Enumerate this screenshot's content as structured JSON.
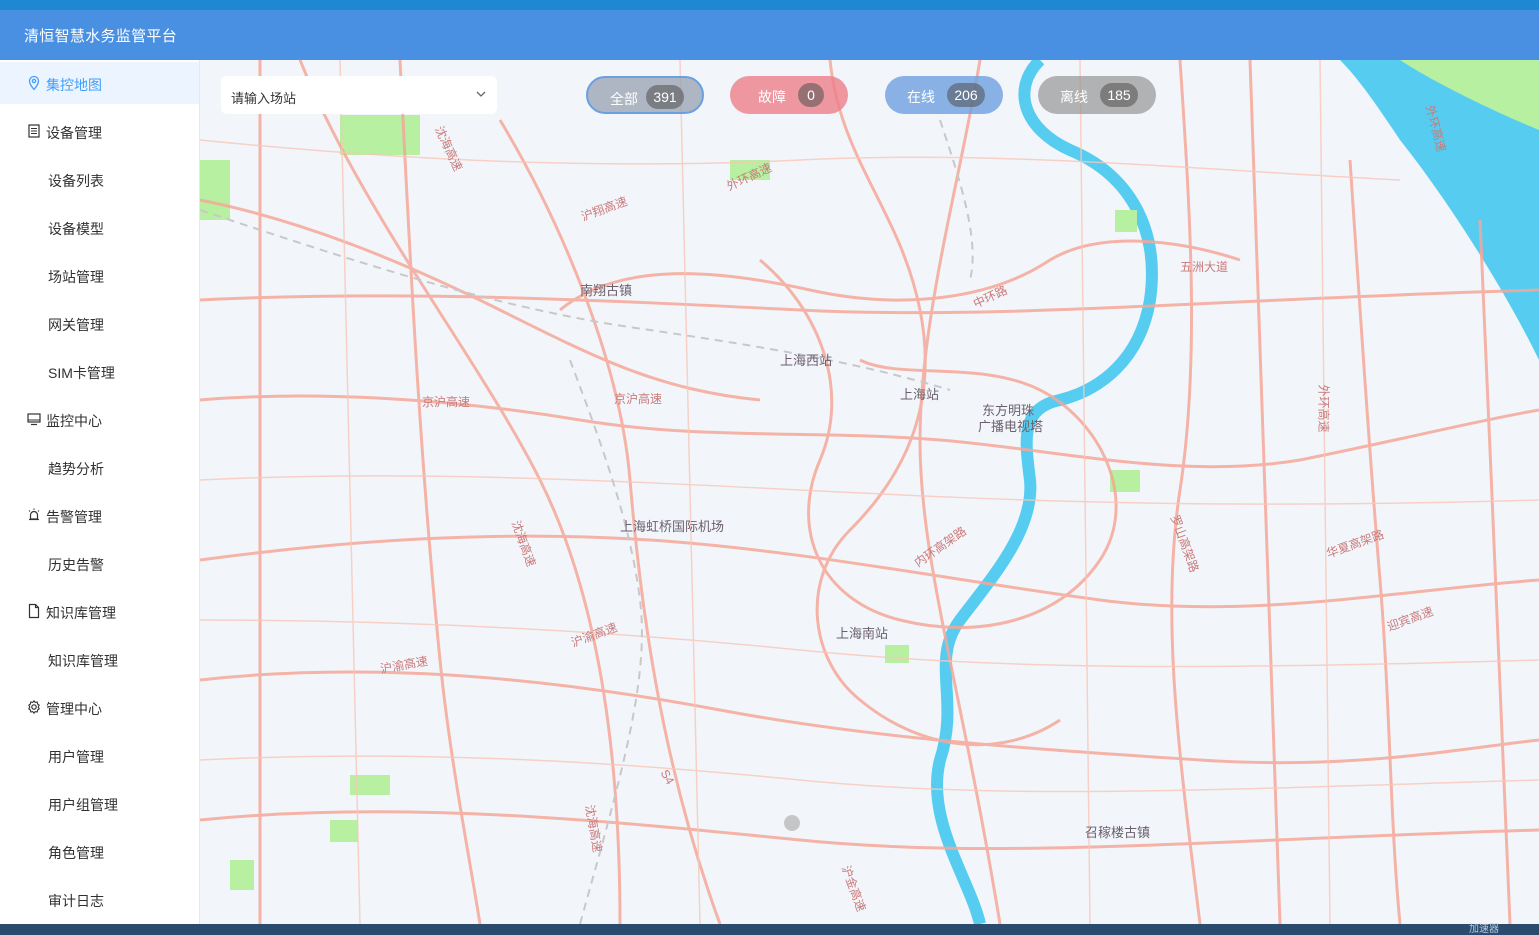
{
  "app": {
    "title": "清恒智慧水务监管平台"
  },
  "sidebar": {
    "items": [
      {
        "label": "集控地图",
        "icon": "location-pin-icon",
        "active": true
      },
      {
        "label": "设备管理",
        "icon": "device-list-icon"
      },
      {
        "label": "设备列表"
      },
      {
        "label": "设备模型"
      },
      {
        "label": "场站管理"
      },
      {
        "label": "网关管理"
      },
      {
        "label": "SIM卡管理"
      },
      {
        "label": "监控中心",
        "icon": "monitor-icon"
      },
      {
        "label": "趋势分析"
      },
      {
        "label": "告警管理",
        "icon": "alarm-icon"
      },
      {
        "label": "历史告警"
      },
      {
        "label": "知识库管理",
        "icon": "document-icon"
      },
      {
        "label": "知识库管理"
      },
      {
        "label": "管理中心",
        "icon": "gear-icon"
      },
      {
        "label": "用户管理"
      },
      {
        "label": "用户组管理"
      },
      {
        "label": "角色管理"
      },
      {
        "label": "审计日志"
      }
    ]
  },
  "filter": {
    "station_placeholder": "请输入场站",
    "status": {
      "all": {
        "label": "全部",
        "count": "391"
      },
      "fault": {
        "label": "故障",
        "count": "0"
      },
      "online": {
        "label": "在线",
        "count": "206"
      },
      "offline": {
        "label": "离线",
        "count": "185"
      }
    }
  },
  "map": {
    "places": [
      "南翔古镇",
      "上海西站",
      "上海站",
      "东方明珠",
      "广播电视塔",
      "上海虹桥国际机场",
      "上海南站",
      "召稼楼古镇"
    ],
    "roads": [
      "沪翔高速",
      "外环高速",
      "中环路",
      "五洲大道",
      "京沪高速",
      "京沪高速",
      "沈海高速",
      "沈海高速",
      "内环高架路",
      "罗山高架路",
      "华夏高架路",
      "迎宾高速",
      "沪渝高速",
      "沪渝高速",
      "外环高速",
      "沈海高速",
      "S4",
      "沪金高速",
      "外环高速"
    ],
    "colors": {
      "water": "#56cdf0",
      "road": "#f5a898",
      "green": "#b6f0a0",
      "land": "#f2f6fb"
    }
  },
  "statusbar": {
    "accelerator": "加速器"
  }
}
